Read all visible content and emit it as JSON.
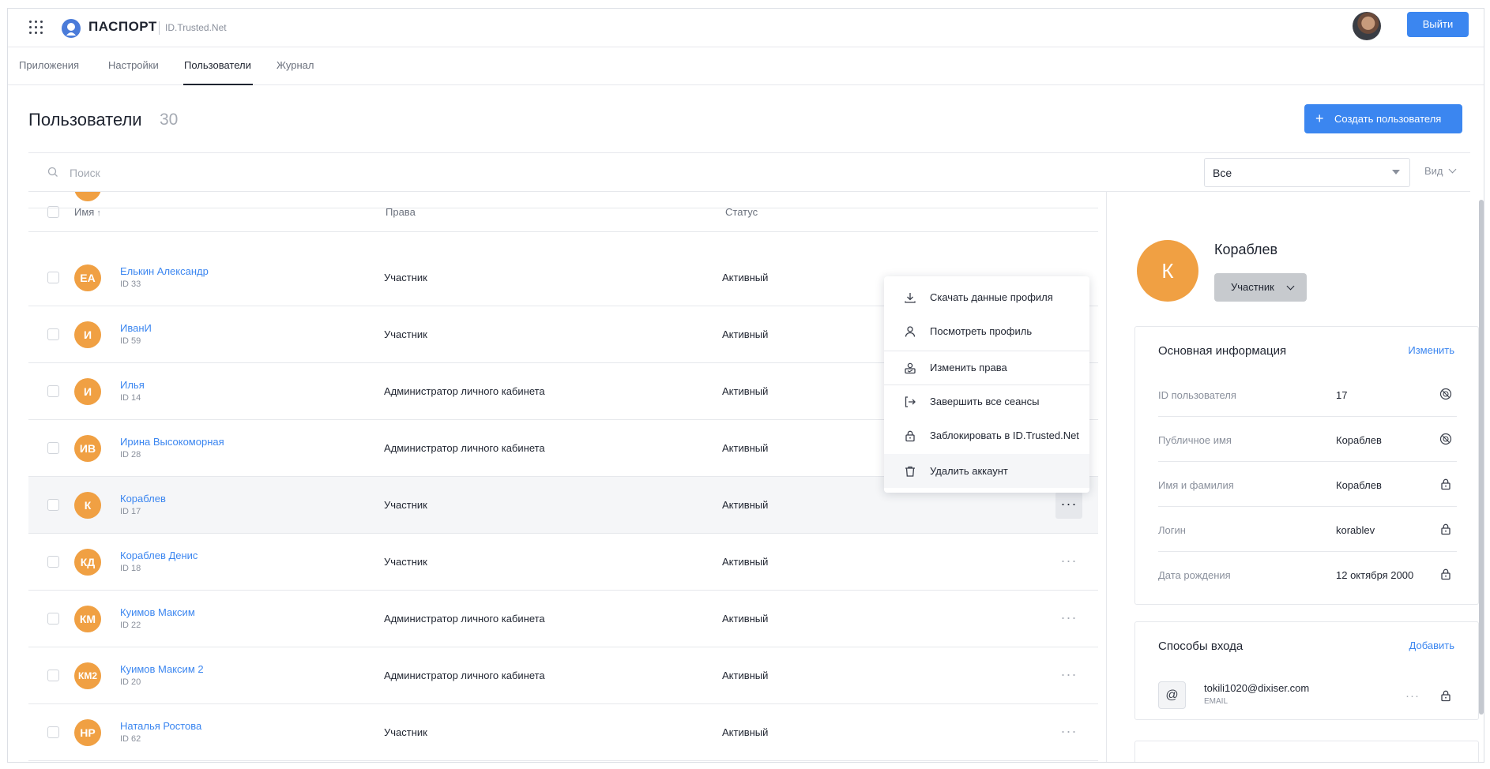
{
  "app": {
    "brand": "ПАСПОРТ",
    "brand_sub": "ID.Trusted.Net",
    "logout_label": "Выйти"
  },
  "nav": {
    "tabs": [
      "Приложения",
      "Настройки",
      "Пользователи",
      "Журнал"
    ],
    "active": "Пользователи"
  },
  "page": {
    "title": "Пользователи",
    "count": "30",
    "create_label": "Создать пользователя"
  },
  "toolbar": {
    "search_placeholder": "Поиск",
    "filter_value": "Все",
    "view_label": "Вид"
  },
  "table": {
    "columns": {
      "name": "Имя",
      "sort_arrow": "↑",
      "rights": "Права",
      "status": "Статус"
    },
    "rows": [
      {
        "initials": "ЕА",
        "name": "Елькин Александр",
        "id": "ID 33",
        "rights": "Участник",
        "status": "Активный"
      },
      {
        "initials": "И",
        "name": "ИванИ",
        "id": "ID 59",
        "rights": "Участник",
        "status": "Активный"
      },
      {
        "initials": "И",
        "name": "Илья",
        "id": "ID 14",
        "rights": "Администратор личного кабинета",
        "status": "Активный"
      },
      {
        "initials": "ИВ",
        "name": "Ирина Высокоморная",
        "id": "ID 28",
        "rights": "Администратор личного кабинета",
        "status": "Активный"
      },
      {
        "initials": "К",
        "name": "Кораблев",
        "id": "ID 17",
        "rights": "Участник",
        "status": "Активный"
      },
      {
        "initials": "КД",
        "name": "Кораблев Денис",
        "id": "ID 18",
        "rights": "Участник",
        "status": "Активный"
      },
      {
        "initials": "КМ",
        "name": "Куимов Максим",
        "id": "ID 22",
        "rights": "Администратор личного кабинета",
        "status": "Активный"
      },
      {
        "initials": "КМ2",
        "name": "Куимов Максим 2",
        "id": "ID 20",
        "rights": "Администратор личного кабинета",
        "status": "Активный"
      },
      {
        "initials": "НР",
        "name": "Наталья Ростова",
        "id": "ID 62",
        "rights": "Участник",
        "status": "Активный"
      }
    ],
    "more_glyph": "···"
  },
  "context_menu": {
    "items": [
      {
        "label": "Скачать данные профиля",
        "icon": "download-icon"
      },
      {
        "label": "Посмотреть профиль",
        "icon": "user-icon"
      },
      {
        "label": "Изменить права",
        "icon": "user-edit-icon"
      },
      {
        "label": "Завершить все сеансы",
        "icon": "logout-icon"
      },
      {
        "label": "Заблокировать в ID.Trusted.Net",
        "icon": "lock-icon"
      },
      {
        "label": "Удалить аккаунт",
        "icon": "trash-icon"
      }
    ]
  },
  "profile": {
    "initial": "К",
    "name": "Кораблев",
    "role": "Участник",
    "main_info": {
      "title": "Основная информация",
      "edit_label": "Изменить",
      "fields": [
        {
          "label": "ID пользователя",
          "value": "17",
          "icon": "visibility-icon"
        },
        {
          "label": "Публичное имя",
          "value": "Кораблев",
          "icon": "visibility-icon"
        },
        {
          "label": "Имя и фамилия",
          "value": "Кораблев",
          "icon": "lock-icon"
        },
        {
          "label": "Логин",
          "value": "korablev",
          "icon": "lock-icon"
        },
        {
          "label": "Дата рождения",
          "value": "12 октября 2000",
          "icon": "lock-icon"
        }
      ]
    },
    "login_methods": {
      "title": "Способы входа",
      "add_label": "Добавить",
      "badge": "@",
      "email": "tokili1020@dixiser.com",
      "type": "EMAIL"
    }
  },
  "colors": {
    "accent": "#3b86f0",
    "avatar": "#f0a043",
    "row_highlight": "#f5f6f8"
  }
}
